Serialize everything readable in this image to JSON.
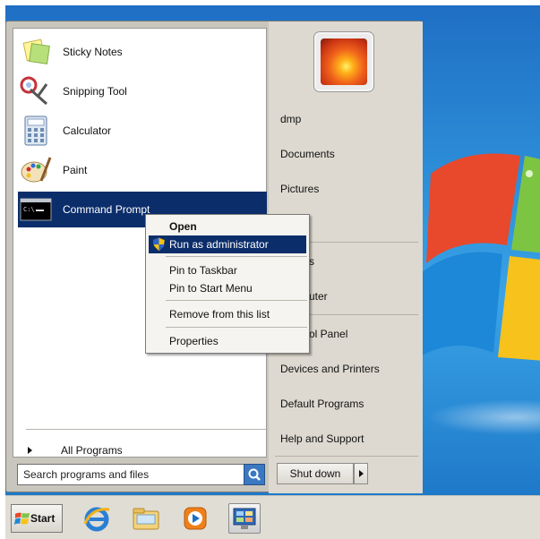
{
  "start_menu": {
    "programs": [
      {
        "label": "Sticky Notes",
        "icon": "sticky-notes-icon"
      },
      {
        "label": "Snipping Tool",
        "icon": "scissors-icon"
      },
      {
        "label": "Calculator",
        "icon": "calculator-icon"
      },
      {
        "label": "Paint",
        "icon": "paint-palette-icon"
      },
      {
        "label": "Command Prompt",
        "icon": "command-prompt-icon",
        "selected": true
      }
    ],
    "all_programs_label": "All Programs",
    "search_placeholder": "Search programs and files",
    "right_items": [
      "dmp",
      "Documents",
      "Pictures",
      "s",
      "uter",
      "ol Panel",
      "Devices and Printers",
      "Default Programs",
      "Help and Support"
    ],
    "shutdown_label": "Shut down"
  },
  "context_menu": {
    "items": [
      {
        "label": "Open",
        "bold": true
      },
      {
        "label": "Run as administrator",
        "highlighted": true,
        "icon": "uac-shield-icon"
      },
      {
        "label": "Pin to Taskbar"
      },
      {
        "label": "Pin to Start Menu"
      },
      {
        "label": "Remove from this list"
      },
      {
        "label": "Properties"
      }
    ]
  },
  "taskbar": {
    "start_label": "Start",
    "icons": [
      "internet-explorer-icon",
      "windows-explorer-icon",
      "media-player-icon",
      "control-panel-icon"
    ]
  },
  "colors": {
    "selection": "#0b2d6a",
    "menu_bg": "#c9c6bd",
    "desktop": "#2d8ed8"
  }
}
